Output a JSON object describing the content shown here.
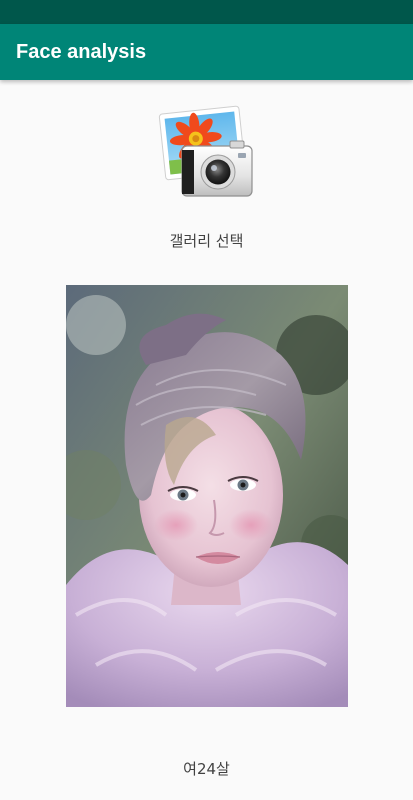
{
  "app": {
    "title": "Face analysis",
    "colors": {
      "status_bar": "#00574b",
      "app_bar": "#008577",
      "background": "#fafafa"
    }
  },
  "main": {
    "gallery_button": {
      "icon": "gallery-camera-icon",
      "label": "갤러리 선택"
    },
    "photo": {
      "description_icon": "portrait-photo"
    },
    "result_text": "여24살"
  }
}
